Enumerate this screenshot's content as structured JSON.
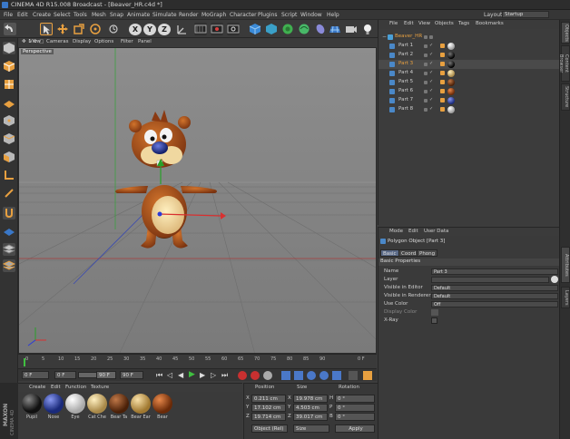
{
  "title_bar": {
    "title": "CINEMA 4D R15.008 Broadcast - [Beaver_HR.c4d *]"
  },
  "menu": [
    "File",
    "Edit",
    "Create",
    "Select",
    "Tools",
    "Mesh",
    "Snap",
    "Animate",
    "Simulate",
    "Render",
    "MoGraph",
    "Character",
    "Plugins",
    "Script",
    "Window",
    "Help"
  ],
  "layout": {
    "label": "Layout:",
    "value": "Startup"
  },
  "toolbar": {
    "axis_x": "X",
    "axis_y": "Y",
    "axis_z": "Z"
  },
  "viewport": {
    "menu": [
      "View",
      "Cameras",
      "Display",
      "Options",
      "Filter",
      "Panel"
    ],
    "label": "Perspective"
  },
  "timeline": {
    "ticks": [
      "0",
      "5",
      "10",
      "15",
      "20",
      "25",
      "30",
      "35",
      "40",
      "45",
      "50",
      "55",
      "60",
      "65",
      "70",
      "75",
      "80",
      "85",
      "90"
    ],
    "end_label": "0 F"
  },
  "transport": {
    "current_frame": "0 F",
    "min_frame": "0 F",
    "preview_max": "90 F",
    "max_frame": "90 F"
  },
  "materials": {
    "menu": [
      "Create",
      "Edit",
      "Function",
      "Texture"
    ],
    "items": [
      {
        "name": "Pupil",
        "color": "#111111"
      },
      {
        "name": "Nose",
        "color": "#2a3a9a"
      },
      {
        "name": "Eye",
        "color": "#e8e8e8"
      },
      {
        "name": "Cat Che",
        "color": "#d8b878"
      },
      {
        "name": "Bear Ta",
        "color": "#8a4a20"
      },
      {
        "name": "Bear Ear",
        "color": "#c8a060"
      },
      {
        "name": "Bear",
        "color": "#a04818"
      }
    ],
    "brand_top": "MAXON",
    "brand_bottom": "CINEMA 4D"
  },
  "coordinates": {
    "headers": {
      "position": "Position",
      "size": "Size",
      "rotation": "Rotation"
    },
    "rows": [
      {
        "axis": "X",
        "pos": "0.211 cm",
        "size_axis": "X",
        "size": "19.978 cm",
        "rot_axis": "H",
        "rot": "0 °"
      },
      {
        "axis": "Y",
        "pos": "17.102 cm",
        "size_axis": "Y",
        "size": "4.503 cm",
        "rot_axis": "P",
        "rot": "0 °"
      },
      {
        "axis": "Z",
        "pos": "19.714 cm",
        "size_axis": "Z",
        "size": "39.017 cm",
        "rot_axis": "B",
        "rot": "0 °"
      }
    ],
    "mode": "Object (Rel)",
    "size_mode": "Size",
    "apply": "Apply"
  },
  "objects": {
    "menu": [
      "File",
      "Edit",
      "View",
      "Objects",
      "Tags",
      "Bookmarks"
    ],
    "root": "Beaver_HR",
    "items": [
      {
        "name": "Part 1",
        "tag": "#e8e8e8"
      },
      {
        "name": "Part 2",
        "tag": "#111111"
      },
      {
        "name": "Part 3",
        "tag": "#111111",
        "selected": true
      },
      {
        "name": "Part 4",
        "tag": "#d8b878"
      },
      {
        "name": "Part 5",
        "tag": "#8a4a20"
      },
      {
        "name": "Part 6",
        "tag": "#a04818"
      },
      {
        "name": "Part 7",
        "tag": "#2a3a9a"
      },
      {
        "name": "Part 8",
        "tag": "#e8e8e8"
      }
    ]
  },
  "attributes": {
    "menu": [
      "Mode",
      "Edit",
      "User Data"
    ],
    "object_title": "Polygon Object [Part 3]",
    "tabs": [
      "Basic",
      "Coord.",
      "Phong"
    ],
    "section": "Basic Properties",
    "rows": [
      {
        "label": "Name",
        "value": "Part 3"
      },
      {
        "label": "Layer",
        "value": ""
      },
      {
        "label": "Visible in Editor",
        "value": "Default"
      },
      {
        "label": "Visible in Renderer",
        "value": "Default"
      },
      {
        "label": "Use Color",
        "value": "Off"
      },
      {
        "label": "Display Color",
        "value": ""
      },
      {
        "label": "X-Ray",
        "value": ""
      }
    ]
  },
  "right_tabs": [
    "Objects",
    "Content Browser",
    "Structure",
    "Attributes",
    "Layers"
  ],
  "colors": {
    "accent": "#e8a040",
    "selection": "#e8a040",
    "bg": "#3c3c3c"
  }
}
